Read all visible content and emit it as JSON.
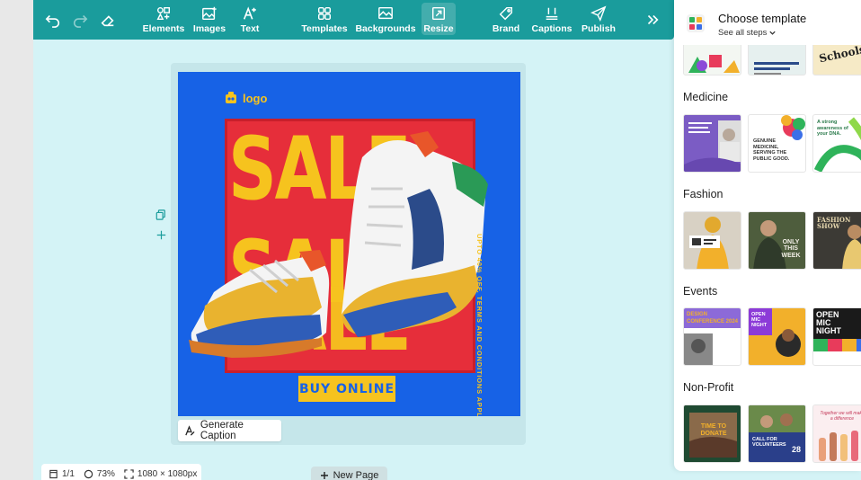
{
  "toolbar": {
    "buttons": [
      {
        "label": "Elements",
        "icon": "elements-icon"
      },
      {
        "label": "Images",
        "icon": "images-icon"
      },
      {
        "label": "Text",
        "icon": "text-icon"
      },
      {
        "label": "Templates",
        "icon": "templates-icon"
      },
      {
        "label": "Backgrounds",
        "icon": "backgrounds-icon"
      },
      {
        "label": "Resize",
        "icon": "resize-icon"
      },
      {
        "label": "Brand",
        "icon": "brand-icon"
      },
      {
        "label": "Captions",
        "icon": "captions-icon"
      },
      {
        "label": "Publish",
        "icon": "publish-icon"
      }
    ],
    "active": "Resize",
    "accent": "#1a9c9c"
  },
  "design": {
    "logo_text": "logo",
    "sale_word": "SALE",
    "vertical_text": "UPTO 40% OFF. TERMS AND CONDITIONS APPLY",
    "cta": "BUY ONLINE",
    "colors": {
      "background": "#1762e6",
      "panel": "#e62e3a",
      "accent": "#f6c31e"
    }
  },
  "canvas": {
    "generate_caption": "Generate Caption"
  },
  "status": {
    "pages": "1/1",
    "zoom": "73%",
    "size": "1080 × 1080px",
    "new_page": "New Page"
  },
  "panel": {
    "title": "Choose template",
    "subtitle": "See all steps",
    "sections": [
      {
        "title": "Medicine",
        "thumbs": [
          "medicine-template-1",
          "medicine-template-2",
          "medicine-template-3"
        ]
      },
      {
        "title": "Fashion",
        "thumbs": [
          "fashion-template-1",
          "fashion-template-2",
          "fashion-template-3"
        ]
      },
      {
        "title": "Events",
        "thumbs": [
          "events-template-1",
          "events-template-2",
          "events-template-3"
        ]
      },
      {
        "title": "Non-Profit",
        "thumbs": [
          "nonprofit-template-1",
          "nonprofit-template-2",
          "nonprofit-template-3"
        ]
      }
    ],
    "thumb_text": {
      "med2": "GENUINE MEDICINE, SERVING THE PUBLIC GOOD.",
      "med3": "A strong awareness of your DNA.",
      "fash2": "ONLY THIS WEEK",
      "fash3": "FASHION SHOW",
      "ev1": "DESIGN CONFERENCE 2024",
      "ev2": "OPEN MIC NIGHT",
      "ev3": "OPEN MIC NIGHT",
      "np1": "TIME TO DONATE",
      "np2": "CALL FOR VOLUNTEERS",
      "np2b": "28",
      "np3": "Together we will make a difference",
      "top3": "Schools"
    }
  }
}
